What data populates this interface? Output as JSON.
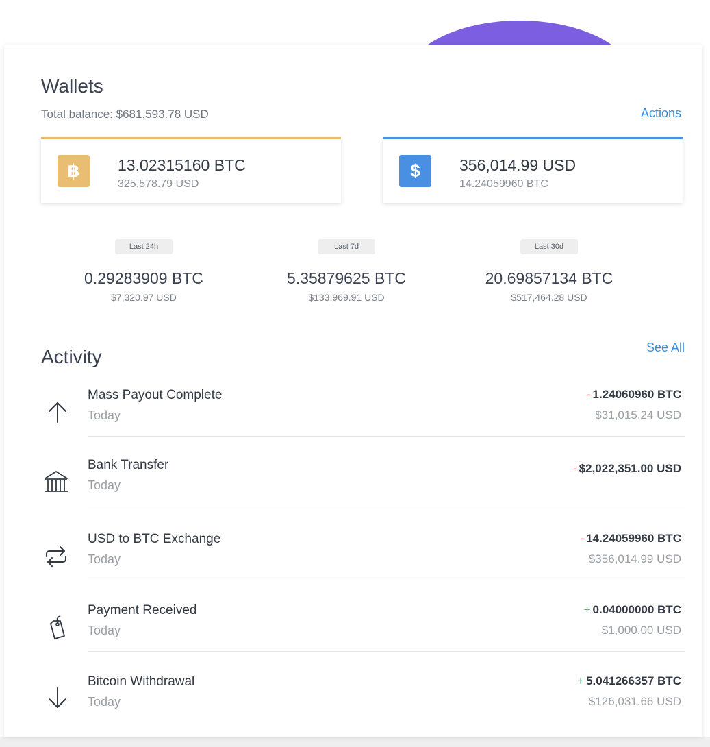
{
  "colors": {
    "btc": "#e9bd72",
    "usd": "#4a90e2",
    "accent_link": "#3b8de0",
    "negative": "#e0565b",
    "positive": "#3fbf7f",
    "decor_purple": "#7b5fe0"
  },
  "wallets": {
    "title": "Wallets",
    "total_balance": "Total balance: $681,593.78 USD",
    "actions_label": "Actions",
    "cards": [
      {
        "icon": "bitcoin-icon",
        "glyph": "฿",
        "primary": "13.02315160 BTC",
        "secondary": "325,578.79 USD"
      },
      {
        "icon": "dollar-icon",
        "glyph": "$",
        "primary": "356,014.99 USD",
        "secondary": "14.24059960 BTC"
      }
    ]
  },
  "stats": [
    {
      "period": "Last 24h",
      "btc": "0.29283909 BTC",
      "usd": "$7,320.97 USD"
    },
    {
      "period": "Last 7d",
      "btc": "5.35879625 BTC",
      "usd": "$133,969.91 USD"
    },
    {
      "period": "Last 30d",
      "btc": "20.69857134 BTC",
      "usd": "$517,464.28 USD"
    }
  ],
  "activity": {
    "title": "Activity",
    "see_all_label": "See All",
    "items": [
      {
        "icon": "arrow-up-icon",
        "name": "Mass Payout Complete",
        "when": "Today",
        "sign": "-",
        "amount": "1.24060960 BTC",
        "usd": "$31,015.24 USD"
      },
      {
        "icon": "bank-icon",
        "name": "Bank Transfer",
        "when": "Today",
        "sign": "-",
        "amount": "$2,022,351.00 USD",
        "usd": ""
      },
      {
        "icon": "exchange-icon",
        "name": "USD to BTC Exchange",
        "when": "Today",
        "sign": "-",
        "amount": "14.24059960 BTC",
        "usd": "$356,014.99 USD"
      },
      {
        "icon": "tag-icon",
        "name": "Payment Received",
        "when": "Today",
        "sign": "+",
        "amount": "0.04000000 BTC",
        "usd": "$1,000.00 USD"
      },
      {
        "icon": "arrow-down-icon",
        "name": "Bitcoin Withdrawal",
        "when": "Today",
        "sign": "+",
        "amount": "5.041266357 BTC",
        "usd": "$126,031.66 USD"
      }
    ]
  }
}
